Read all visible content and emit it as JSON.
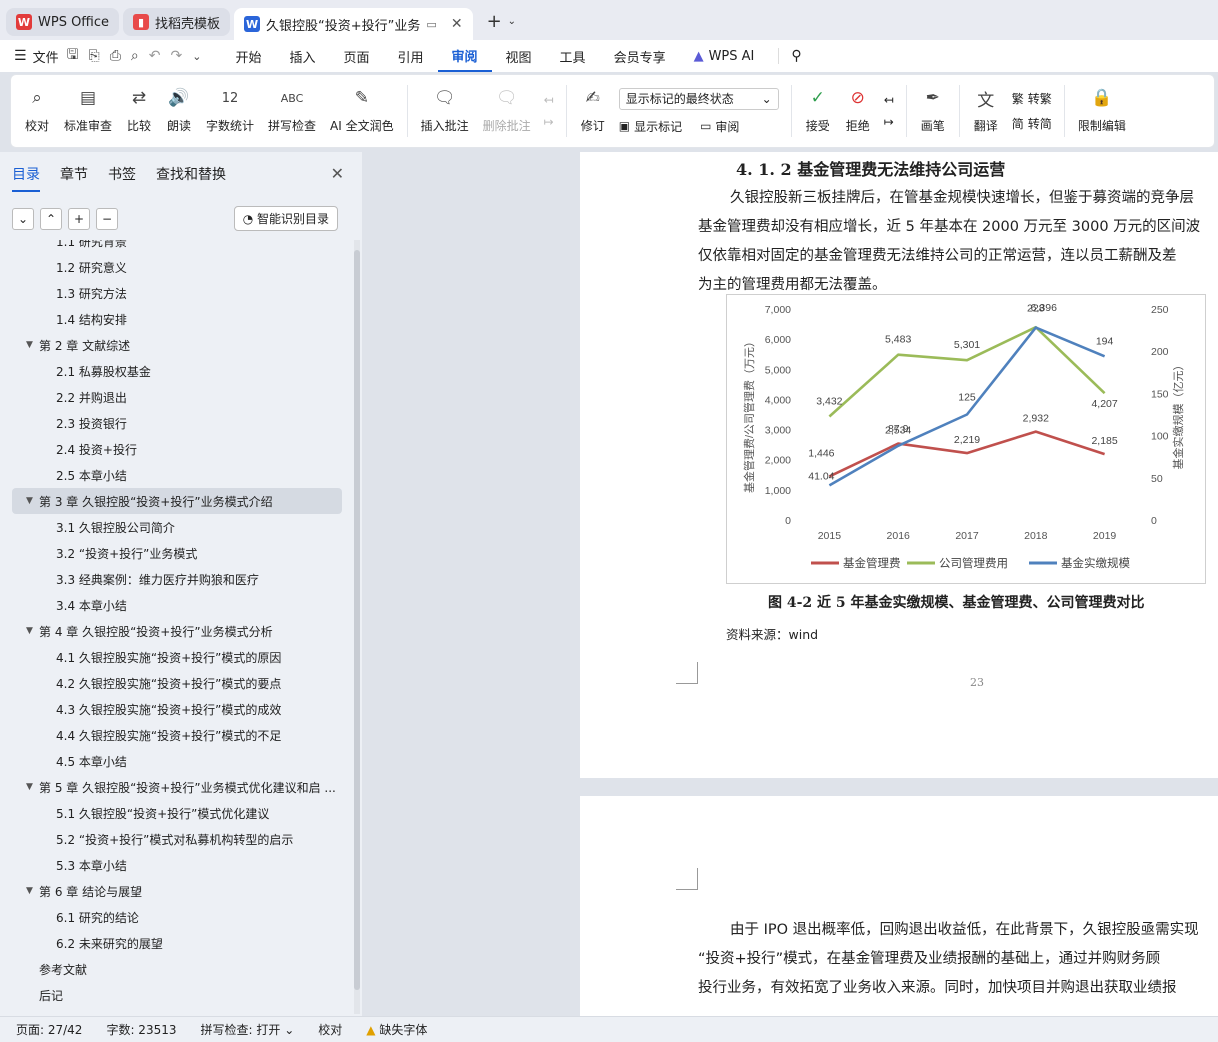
{
  "tabs": [
    {
      "title": "WPS Office",
      "icon": "wps-logo-icon"
    },
    {
      "title": "找稻壳模板",
      "icon": "docer-logo-icon"
    },
    {
      "title": "久银控股“投资+投行”业务",
      "icon": "writer-logo-icon"
    }
  ],
  "menu": {
    "file": "文件",
    "items": [
      "开始",
      "插入",
      "页面",
      "引用",
      "审阅",
      "视图",
      "工具",
      "会员专享"
    ],
    "active": "审阅",
    "ai": "WPS AI"
  },
  "ribbon": {
    "proofread": "校对",
    "standard_review": "标准审查",
    "compare": "比较",
    "read_aloud": "朗读",
    "word_count": "字数统计",
    "spell_check": "拼写检查",
    "ai_polish": "AI 全文润色",
    "insert_comment": "插入批注",
    "delete_comment": "删除批注",
    "revise": "修订",
    "display_select": "显示标记的最终状态",
    "show_markup": "显示标记",
    "review": "审阅",
    "accept": "接受",
    "reject": "拒绝",
    "pen": "画笔",
    "translate": "翻译",
    "to_traditional": "转繁",
    "to_simplified": "转简",
    "restrict_edit": "限制编辑"
  },
  "sidebar": {
    "tabs": [
      "目录",
      "章节",
      "书签",
      "查找和替换"
    ],
    "smart_toc": "智能识别目录",
    "toc": [
      {
        "level": 2,
        "text": "1.1  研究背景"
      },
      {
        "level": 2,
        "text": "1.2  研究意义"
      },
      {
        "level": 2,
        "text": "1.3  研究方法"
      },
      {
        "level": 2,
        "text": "1.4  结构安排"
      },
      {
        "level": 1,
        "text": "第 2 章  文献综述"
      },
      {
        "level": 2,
        "text": "2.1  私募股权基金"
      },
      {
        "level": 2,
        "text": "2.2  并购退出"
      },
      {
        "level": 2,
        "text": "2.3  投资银行"
      },
      {
        "level": 2,
        "text": "2.4  投资+投行"
      },
      {
        "level": 2,
        "text": "2.5  本章小结"
      },
      {
        "level": 1,
        "text": "第 3 章  久银控股“投资+投行”业务模式介绍",
        "selected": true
      },
      {
        "level": 2,
        "text": "3.1  久银控股公司简介"
      },
      {
        "level": 2,
        "text": "3.2  “投资+投行”业务模式"
      },
      {
        "level": 2,
        "text": "3.3  经典案例：维力医疗并购狼和医疗"
      },
      {
        "level": 2,
        "text": "3.4  本章小结"
      },
      {
        "level": 1,
        "text": "第 4 章  久银控股“投资+投行”业务模式分析"
      },
      {
        "level": 2,
        "text": "4.1  久银控股实施“投资+投行”模式的原因"
      },
      {
        "level": 2,
        "text": "4.2  久银控股实施“投资+投行”模式的要点"
      },
      {
        "level": 2,
        "text": "4.3  久银控股实施“投资+投行”模式的成效"
      },
      {
        "level": 2,
        "text": "4.4  久银控股实施“投资+投行”模式的不足"
      },
      {
        "level": 2,
        "text": "4.5  本章小结"
      },
      {
        "level": 1,
        "text": "第 5 章  久银控股“投资+投行”业务模式优化建议和启 ..."
      },
      {
        "level": 2,
        "text": "5.1  久银控股“投资+投行”模式优化建议"
      },
      {
        "level": 2,
        "text": "5.2  “投资+投行”模式对私募机构转型的启示"
      },
      {
        "level": 2,
        "text": "5.3  本章小结"
      },
      {
        "level": 1,
        "text": "第 6 章  结论与展望"
      },
      {
        "level": 2,
        "text": "6.1  研究的结论"
      },
      {
        "level": 2,
        "text": "6.2  未来研究的展望"
      },
      {
        "level": 0,
        "text": "参考文献"
      },
      {
        "level": 0,
        "text": "后记"
      }
    ]
  },
  "document": {
    "heading": "4. 1. 2  基金管理费无法维持公司运营",
    "para1": [
      "久银控股新三板挂牌后，在管基金规模快速增长，但鉴于募资端的竞争层",
      "基金管理费却没有相应增长，近 5 年基本在 2000 万元至 3000 万元的区间波",
      "仅依靠相对固定的基金管理费无法维持公司的正常运营，连以员工薪酬及差",
      "为主的管理费用都无法覆盖。"
    ],
    "caption": "图 4-2  近 5 年基金实缴规模、基金管理费、公司管理费对比",
    "source": "资料来源：wind",
    "page_number": "23",
    "para2": [
      "由于 IPO 退出概率低，回购退出收益低，在此背景下，久银控股亟需实现",
      "“投资+投行”模式，在基金管理费及业绩报酬的基础上，通过并购财务顾",
      "投行业务，有效拓宽了业务收入来源。同时，加快项目并购退出获取业绩报"
    ]
  },
  "chart_data": {
    "type": "line",
    "categories": [
      "2015",
      "2016",
      "2017",
      "2018",
      "2019"
    ],
    "ylabel": "基金管理费/公司管理费（万元）",
    "y2label": "基金实缴规模（亿元）",
    "ylim": [
      0,
      7000
    ],
    "y2lim": [
      0,
      250
    ],
    "yticks": [
      "0",
      "1,000",
      "2,000",
      "3,000",
      "4,000",
      "5,000",
      "6,000",
      "7,000"
    ],
    "y2ticks": [
      "0",
      "50",
      "100",
      "150",
      "200",
      "250"
    ],
    "series": [
      {
        "name": "基金管理费",
        "axis": "left",
        "color": "#c0504d",
        "values": [
          1446,
          2534,
          2219,
          2932,
          2185
        ],
        "labels": [
          "1,446",
          "2,534",
          "2,219",
          "2,932",
          "2,185"
        ]
      },
      {
        "name": "公司管理费用",
        "axis": "left",
        "color": "#9bbb59",
        "values": [
          3432,
          5483,
          5301,
          6396,
          4207
        ],
        "labels": [
          "3,432",
          "5,483",
          "5,301",
          "6,396",
          "4,207"
        ]
      },
      {
        "name": "基金实缴规模",
        "axis": "right",
        "color": "#4f81bd",
        "values": [
          41.04,
          87.9,
          125,
          228,
          194
        ],
        "labels": [
          "41.04",
          "87.9",
          "125",
          "228",
          "194"
        ]
      }
    ],
    "legend": "bottom"
  },
  "status": {
    "page": "页面: 27/42",
    "words": "字数: 23513",
    "spell": "拼写检查: 打开",
    "proof": "校对",
    "missing_font": "缺失字体"
  }
}
